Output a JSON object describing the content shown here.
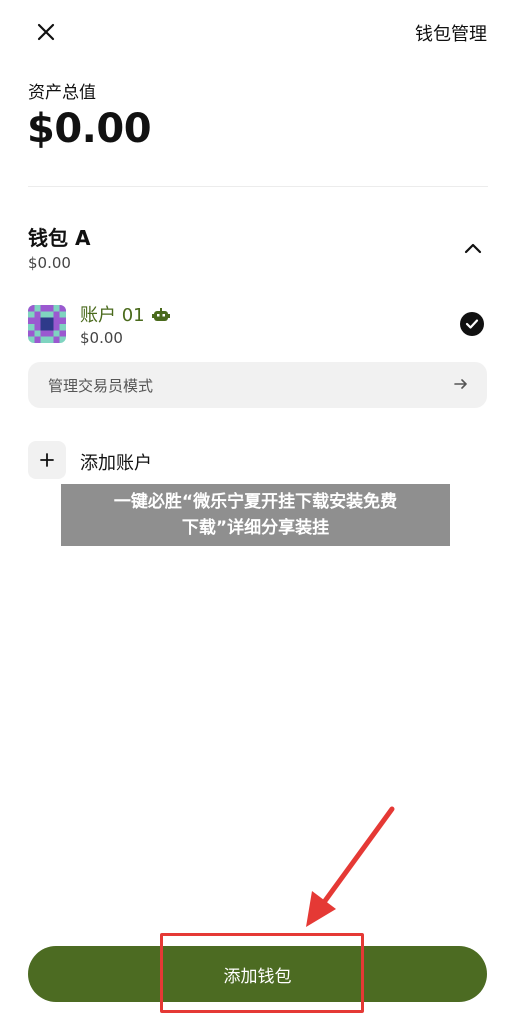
{
  "header": {
    "close_icon": "close-icon",
    "manage_label": "钱包管理"
  },
  "total": {
    "label": "资产总值",
    "value": "$0.00"
  },
  "wallet": {
    "name": "钱包 A",
    "balance": "$0.00",
    "collapse_icon": "chevron-up-icon",
    "account": {
      "name": "账户 01",
      "balance": "$0.00",
      "bot_icon": "bot-icon",
      "selected_icon": "check-circle-icon"
    },
    "trader_mode": {
      "label": "管理交易员模式",
      "arrow_icon": "arrow-right-icon"
    },
    "add_account": {
      "label": "添加账户",
      "icon": "plus-icon"
    }
  },
  "overlay_banner": {
    "line1": "一键必胜“微乐宁夏开挂下载安装免费",
    "line2": "下载”详细分享装挂"
  },
  "footer": {
    "add_wallet_label": "添加钱包"
  },
  "colors": {
    "accent": "#4c6b22",
    "account_name": "#4a6a1c",
    "annotation": "#e53935",
    "banner_bg": "#808080"
  }
}
